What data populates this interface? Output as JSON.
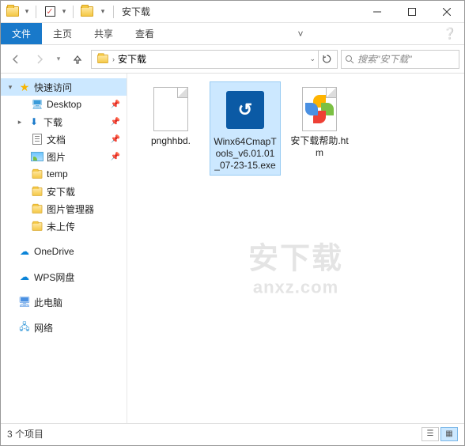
{
  "window": {
    "title": "安下载"
  },
  "ribbon": {
    "file": "文件",
    "home": "主页",
    "share": "共享",
    "view": "查看"
  },
  "address": {
    "seg1": "安下载",
    "search_placeholder": "搜索\"安下载\""
  },
  "sidebar": {
    "quick_access": "快速访问",
    "desktop": "Desktop",
    "downloads": "下载",
    "documents": "文档",
    "pictures": "图片",
    "temp": "temp",
    "anxz": "安下载",
    "picmgr": "图片管理器",
    "notuploaded": "未上传",
    "onedrive": "OneDrive",
    "wps": "WPS网盘",
    "thispc": "此电脑",
    "network": "网络"
  },
  "files": {
    "f1": "pnghhbd.",
    "f2": "Winx64CmapTools_v6.01.01_07-23-15.exe",
    "f3": "安下载帮助.htm"
  },
  "watermark": {
    "main": "安下载",
    "sub": "anxz.com"
  },
  "status": {
    "count": "3 个项目"
  }
}
